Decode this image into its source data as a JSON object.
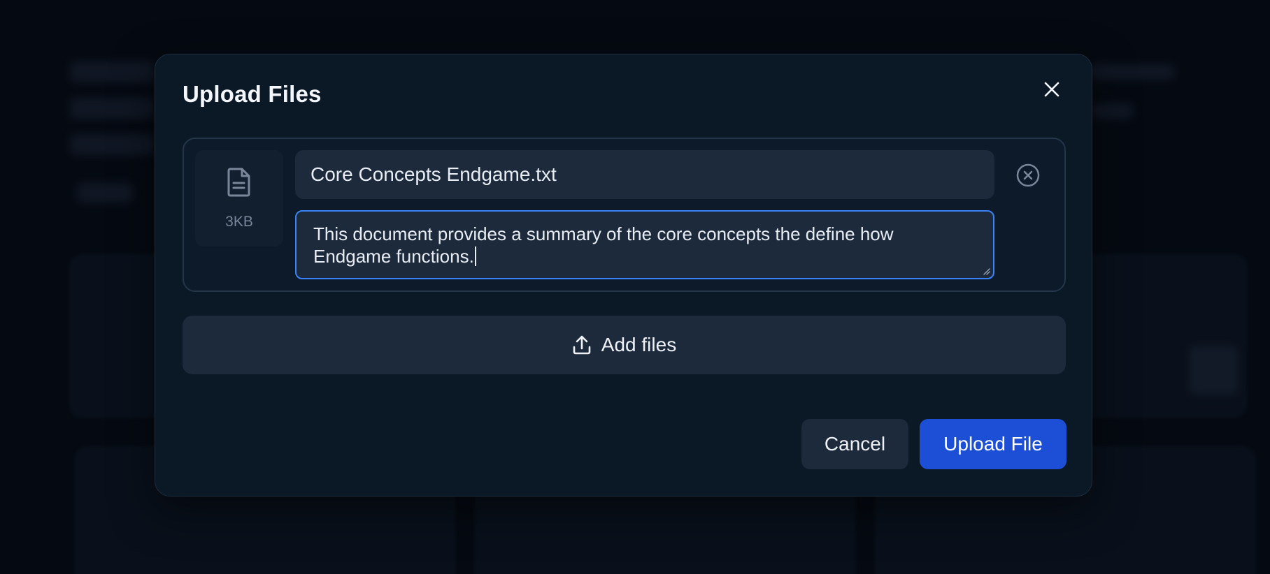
{
  "modal": {
    "title": "Upload Files"
  },
  "file": {
    "size": "3KB",
    "name": "Core Concepts Endgame.txt",
    "description": "This document provides a summary of the core concepts the define how Endgame functions."
  },
  "add_files_label": "Add files",
  "buttons": {
    "cancel_label": "Cancel",
    "upload_label": "Upload File"
  },
  "colors": {
    "accent": "#3b82f6",
    "primary_button": "#1d4fd6",
    "modal_bg": "#0b1826",
    "field_bg": "#1c2a3c"
  },
  "icons": {
    "close": "close-icon",
    "document": "document-icon",
    "remove": "remove-circle-icon",
    "upload": "upload-icon"
  }
}
